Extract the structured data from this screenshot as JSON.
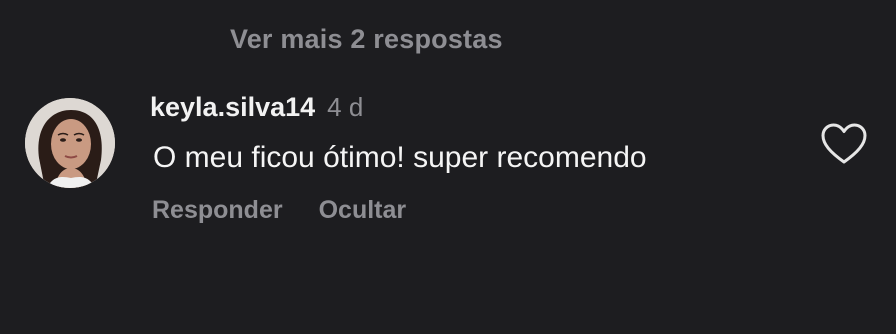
{
  "thread": {
    "more_replies_label": "Ver mais 2 respostas"
  },
  "comment": {
    "username": "keyla.silva14",
    "time": "4 d",
    "text": "O meu ficou ótimo! super recomendo",
    "avatar_icon": "user-avatar",
    "like_icon": "heart-outline-icon"
  },
  "actions": {
    "reply_label": "Responder",
    "hide_label": "Ocultar"
  },
  "colors": {
    "background": "#1d1d20",
    "primary_text": "#f2f2f2",
    "secondary_text": "#8e8e93"
  }
}
